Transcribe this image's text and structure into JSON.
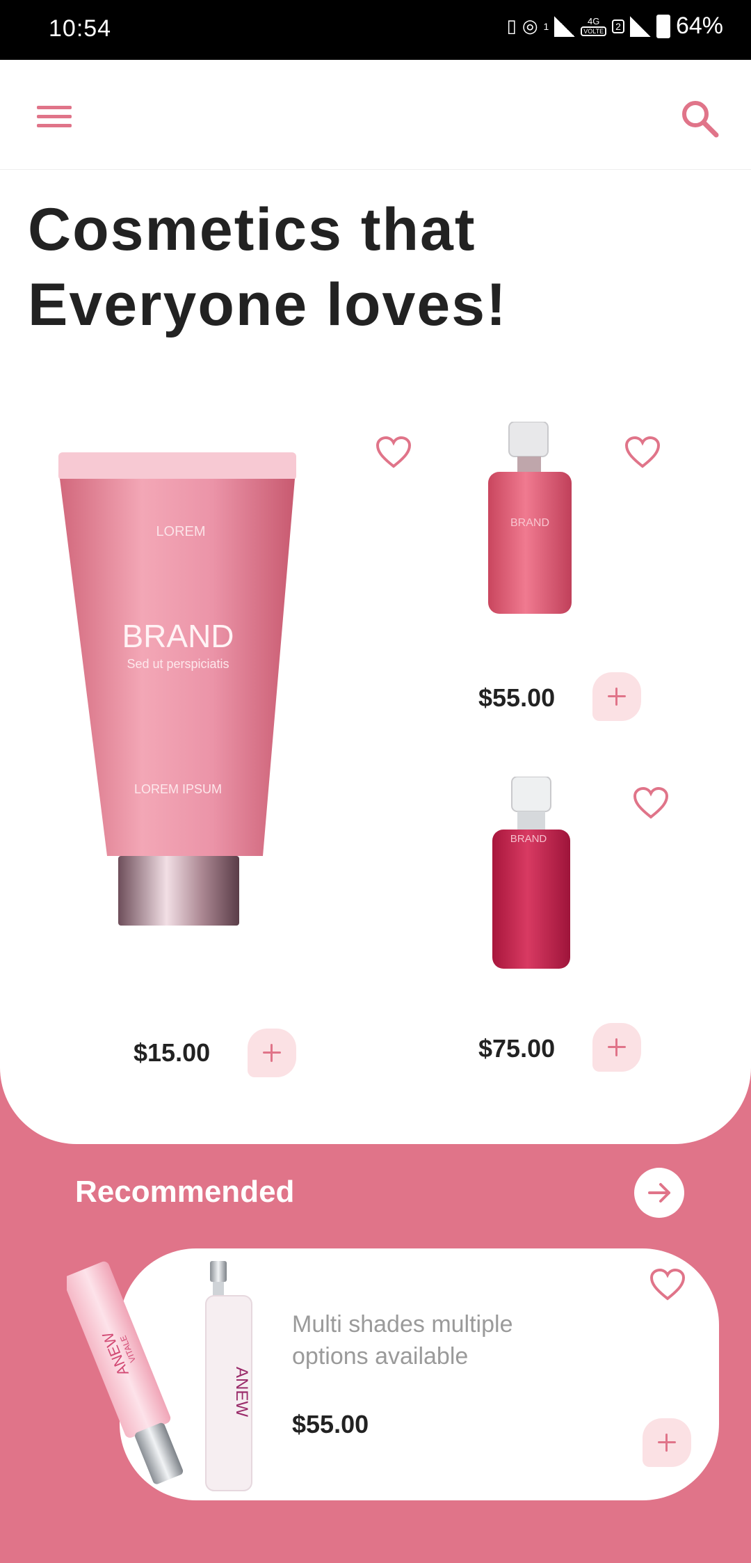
{
  "status_bar": {
    "time": "10:54",
    "battery": "64%",
    "network": "4G",
    "volte": "VOLTE",
    "sim_one": "1",
    "sim_two": "2"
  },
  "header": {
    "menu_icon": "hamburger-menu-icon",
    "search_icon": "search-icon"
  },
  "headline": "Cosmetics that Everyone loves!",
  "products": [
    {
      "image_brand": "BRAND",
      "price": "$15.00",
      "favorite_icon": "heart-icon",
      "add_icon": "plus-icon"
    },
    {
      "image_brand": "BRAND",
      "price": "$55.00",
      "favorite_icon": "heart-icon",
      "add_icon": "plus-icon"
    },
    {
      "image_brand": "BRAND",
      "price": "$75.00",
      "favorite_icon": "heart-icon",
      "add_icon": "plus-icon"
    }
  ],
  "image_text": {
    "tube_top": "LOREM",
    "tube_brand": "BRAND",
    "tube_tagline": "Sed ut perspiciatis",
    "tube_bottom": "LOREM IPSUM",
    "rec_brand": "ANEW",
    "rec_sub": "VITALE"
  },
  "recommended": {
    "title": "Recommended",
    "arrow_icon": "arrow-right-icon",
    "item": {
      "description": "Multi shades multiple options available",
      "price": "$55.00",
      "favorite_icon": "heart-icon",
      "add_icon": "plus-icon"
    }
  },
  "colors": {
    "accent": "#e07489",
    "accent_light": "#fbe1e4",
    "text_dark": "#222222",
    "text_muted": "#9a9a9a"
  }
}
